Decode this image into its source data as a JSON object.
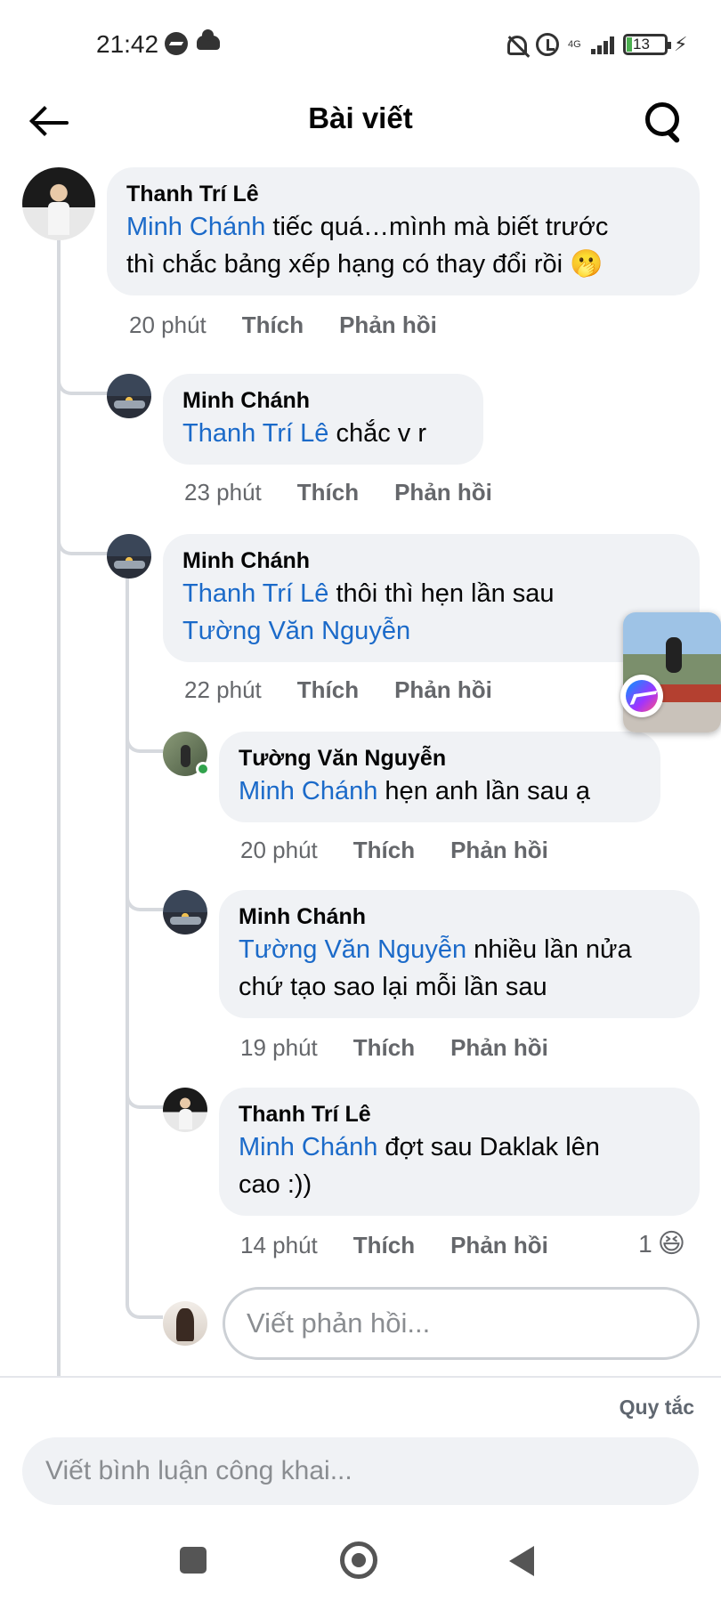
{
  "status_bar": {
    "time": "21:42",
    "network": "4G",
    "battery": "13"
  },
  "header": {
    "title": "Bài viết"
  },
  "comments": [
    {
      "author": "Thanh Trí Lê",
      "mention": "Minh Chánh",
      "text_line1": " tiếc quá…mình mà biết trước",
      "text_line2": "thì chắc bảng xếp hạng có thay đổi rồi",
      "emoji": "🫢",
      "time": "20 phút",
      "like": "Thích",
      "reply": "Phản hồi"
    },
    {
      "author": "Minh Chánh",
      "mention": "Thanh Trí Lê",
      "text": " chắc v r",
      "time": "23 phút",
      "like": "Thích",
      "reply": "Phản hồi"
    },
    {
      "author": "Minh Chánh",
      "mention": "Thanh Trí Lê",
      "text": " thôi thì hẹn lần sau",
      "mention2": "Tường Văn Nguyễn",
      "time": "22 phút",
      "like": "Thích",
      "reply": "Phản hồi"
    },
    {
      "author": "Tường Văn Nguyễn",
      "mention": "Minh Chánh",
      "text": " hẹn anh lần sau ạ",
      "time": "20 phút",
      "like": "Thích",
      "reply": "Phản hồi"
    },
    {
      "author": "Minh Chánh",
      "mention": "Tường Văn Nguyễn",
      "text_line1": " nhiều lần nửa",
      "text_line2": "chứ tạo sao lại mỗi lần sau",
      "time": "19 phút",
      "like": "Thích",
      "reply": "Phản hồi"
    },
    {
      "author": "Thanh Trí Lê",
      "mention": "Minh Chánh",
      "text_line1": " đợt sau Daklak lên",
      "text_line2": "cao :))",
      "time": "14 phút",
      "like": "Thích",
      "reply": "Phản hồi",
      "reaction_count": "1",
      "reaction_emoji": "😆"
    }
  ],
  "reply_box": {
    "placeholder": "Viết phản hồi..."
  },
  "footer": {
    "rules_label": "Quy tắc",
    "comment_placeholder": "Viết bình luận công khai..."
  },
  "icons": {
    "back": "arrow-left-icon",
    "search": "search-icon",
    "messenger": "messenger-icon",
    "nav_recents": "square-icon",
    "nav_home": "circle-icon",
    "nav_back": "triangle-icon"
  },
  "colors": {
    "mention": "#1b6ac9",
    "bubble": "#f0f2f5",
    "meta": "#65676b",
    "online": "#31a24c"
  }
}
